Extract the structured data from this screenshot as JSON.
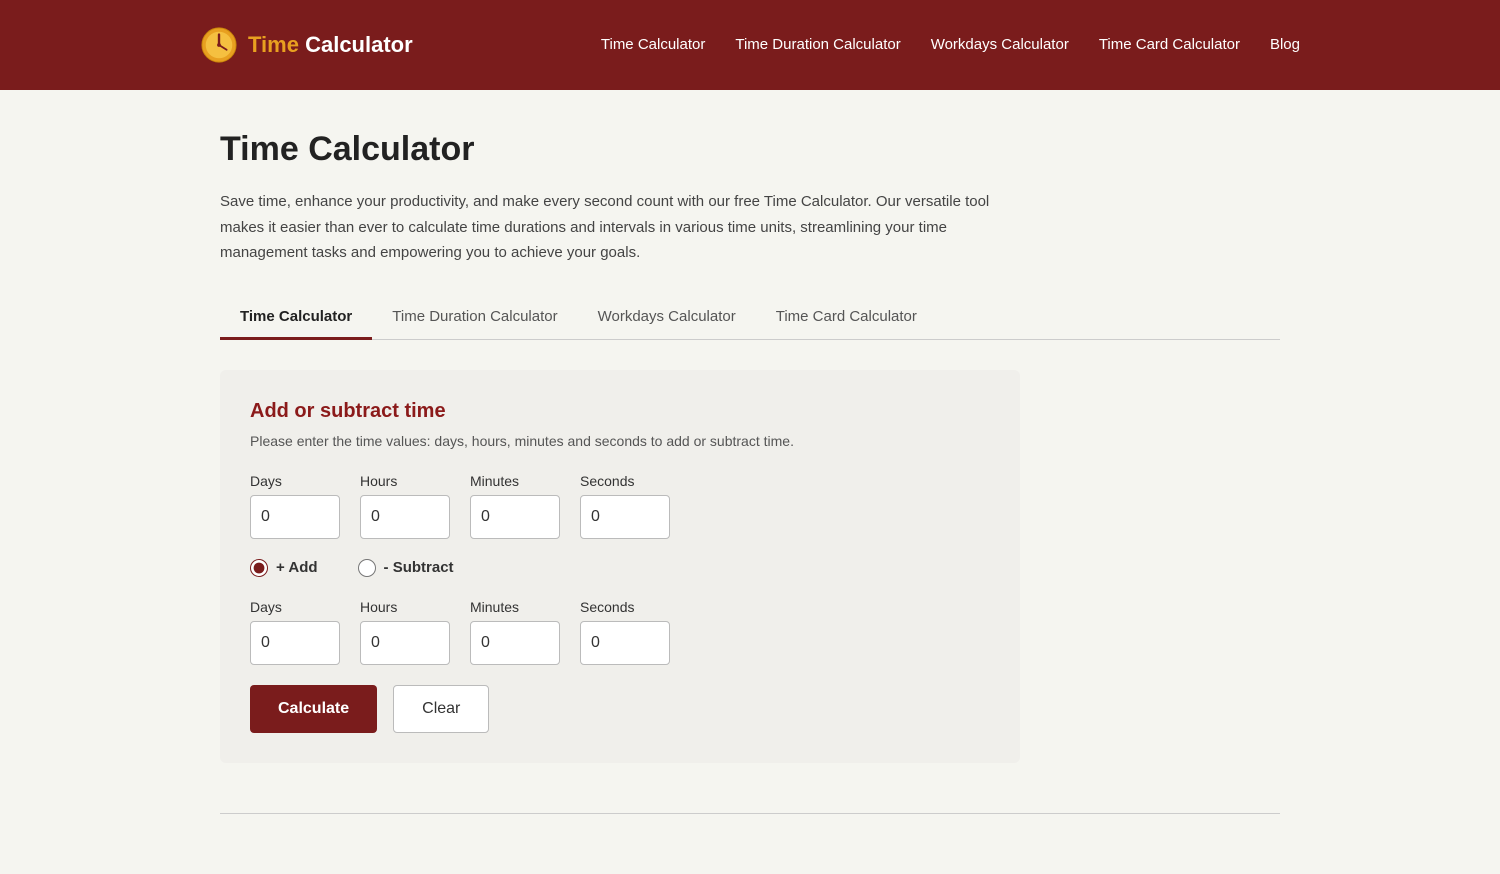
{
  "nav": {
    "logo_time": "Time",
    "logo_calc": "Calculator",
    "links": [
      {
        "label": "Time Calculator",
        "id": "nav-time-calc"
      },
      {
        "label": "Time Duration Calculator",
        "id": "nav-duration-calc"
      },
      {
        "label": "Workdays Calculator",
        "id": "nav-workdays-calc"
      },
      {
        "label": "Time Card Calculator",
        "id": "nav-timecard-calc"
      },
      {
        "label": "Blog",
        "id": "nav-blog"
      }
    ]
  },
  "page": {
    "title": "Time Calculator",
    "description": "Save time, enhance your productivity, and make every second count with our free Time Calculator. Our versatile tool makes it easier than ever to calculate time durations and intervals in various time units, streamlining your time management tasks and empowering you to achieve your goals."
  },
  "tabs": [
    {
      "label": "Time Calculator",
      "active": true
    },
    {
      "label": "Time Duration Calculator",
      "active": false
    },
    {
      "label": "Workdays Calculator",
      "active": false
    },
    {
      "label": "Time Card Calculator",
      "active": false
    }
  ],
  "calculator": {
    "subtitle": "Add or subtract time",
    "description": "Please enter the time values: days, hours, minutes and seconds to add or subtract time.",
    "row1": {
      "days_label": "Days",
      "hours_label": "Hours",
      "minutes_label": "Minutes",
      "seconds_label": "Seconds",
      "days_value": "0",
      "hours_value": "0",
      "minutes_value": "0",
      "seconds_value": "0"
    },
    "radio": {
      "add_label": "+ Add",
      "subtract_label": "- Subtract"
    },
    "row2": {
      "days_label": "Days",
      "hours_label": "Hours",
      "minutes_label": "Minutes",
      "seconds_label": "Seconds",
      "days_value": "0",
      "hours_value": "0",
      "minutes_value": "0",
      "seconds_value": "0"
    },
    "calculate_btn": "Calculate",
    "clear_btn": "Clear"
  }
}
